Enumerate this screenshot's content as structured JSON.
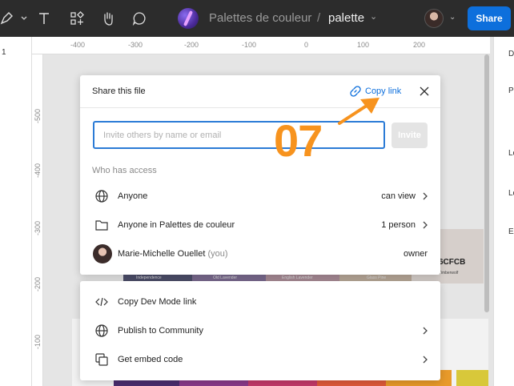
{
  "toolbar": {
    "project_name": "Palettes de couleur",
    "separator": "/",
    "file_name": "palette",
    "share_label": "Share"
  },
  "left_panel": {
    "label": "1"
  },
  "rulers": {
    "top": [
      "-400",
      "-300",
      "-200",
      "-100",
      "0",
      "100",
      "200"
    ],
    "left": [
      "-500",
      "-400",
      "-300",
      "-200",
      "-100"
    ]
  },
  "right_panel": {
    "labels": [
      "D",
      "P",
      "Lo",
      "Lo",
      "Ex"
    ]
  },
  "canvas": {
    "swatch_hex": "6CFCB",
    "swatch_names": [
      "Independence",
      "Old Lavender",
      "English Lavender",
      "Glass Pine",
      "Timberwolf"
    ]
  },
  "dialog": {
    "title": "Share this file",
    "copy_link": "Copy link",
    "invite_placeholder": "Invite others by name or email",
    "invite_button": "Invite",
    "access_heading": "Who has access",
    "access_rows": [
      {
        "label": "Anyone",
        "value": "can view",
        "icon": "globe-icon"
      },
      {
        "label": "Anyone in Palettes de couleur",
        "value": "1 person",
        "icon": "folder-icon"
      },
      {
        "label": "Marie-Michelle Ouellet",
        "suffix": "(you)",
        "value": "owner",
        "icon": "avatar"
      }
    ]
  },
  "dialog2": {
    "rows": [
      {
        "label": "Copy Dev Mode link",
        "icon": "code-icon"
      },
      {
        "label": "Publish to Community",
        "icon": "globe-icon"
      },
      {
        "label": "Get embed code",
        "icon": "embed-icon"
      }
    ]
  },
  "annotation": {
    "step": "07",
    "color": "#f7931e"
  },
  "colors": {
    "accent": "#0d6fdc",
    "toolbar_bg": "#2c2c2c"
  }
}
